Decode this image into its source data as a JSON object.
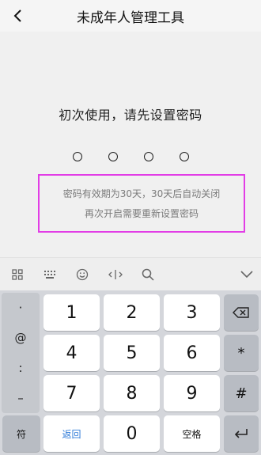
{
  "header": {
    "title": "未成年人管理工具"
  },
  "main": {
    "prompt": "初次使用，请先设置密码",
    "notice_line1": "密码有效期为30天，30天后自动关闭",
    "notice_line2": "再次开启需要重新设置密码",
    "notice_border_color": "#e23de6"
  },
  "keyboard": {
    "symbols": [
      "·",
      "@",
      ":",
      "–"
    ],
    "digits": [
      "1",
      "2",
      "3",
      "4",
      "5",
      "6",
      "7",
      "8",
      "9",
      "0"
    ],
    "delete_symbol": "⌫",
    "star": "*",
    "hash": "#",
    "symbol_key": "符",
    "back_key": "返回",
    "space_key": "空格",
    "enter_symbol": "↵",
    "back_key_color": "#2f7bd8"
  }
}
